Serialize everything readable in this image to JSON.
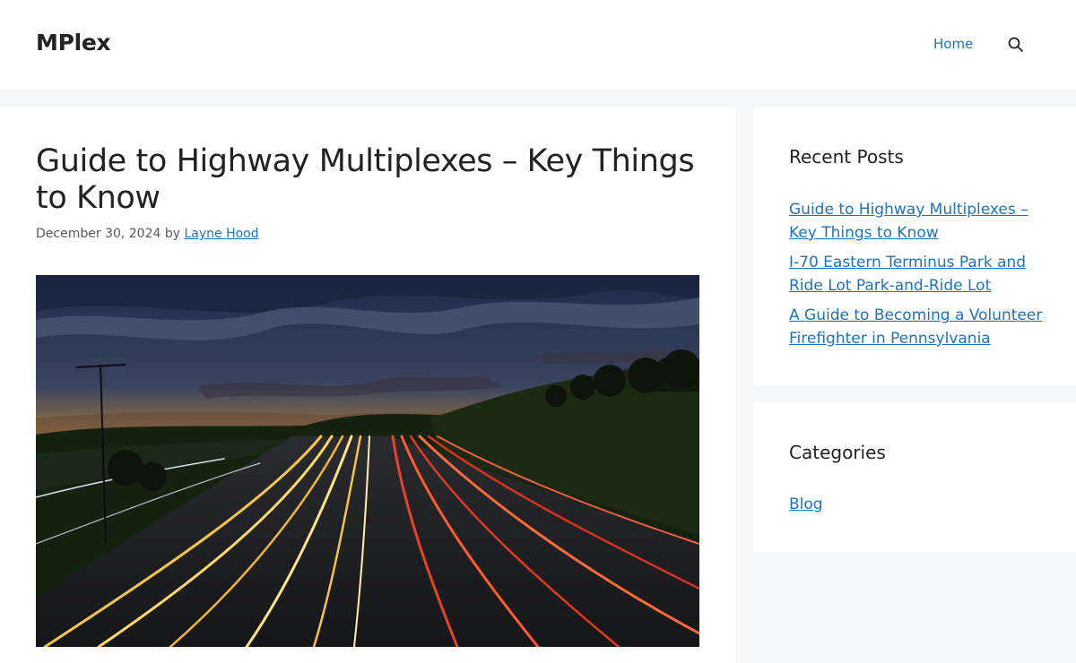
{
  "header": {
    "site_title": "MPlex",
    "nav": {
      "home_label": "Home"
    },
    "search_icon": "search-icon"
  },
  "article": {
    "title": "Guide to Highway Multiplexes – Key Things to Know",
    "date": "December 30, 2024",
    "by": "by",
    "author": "Layne Hood",
    "image_icon": "highway-sunset-light-trails-image"
  },
  "sidebar": {
    "recent_posts": {
      "title": "Recent Posts",
      "items": [
        {
          "label": "Guide to Highway Multiplexes – Key Things to Know"
        },
        {
          "label": "I-70 Eastern Terminus Park and Ride Lot Park-and-Ride Lot"
        },
        {
          "label": "A Guide to Becoming a Volunteer Firefighter in Pennsylvania"
        }
      ]
    },
    "categories": {
      "title": "Categories",
      "items": [
        {
          "label": "Blog"
        }
      ]
    }
  },
  "colors": {
    "link": "#1e73be",
    "background": "#f7f8f9",
    "card": "#ffffff",
    "text": "#222222"
  }
}
